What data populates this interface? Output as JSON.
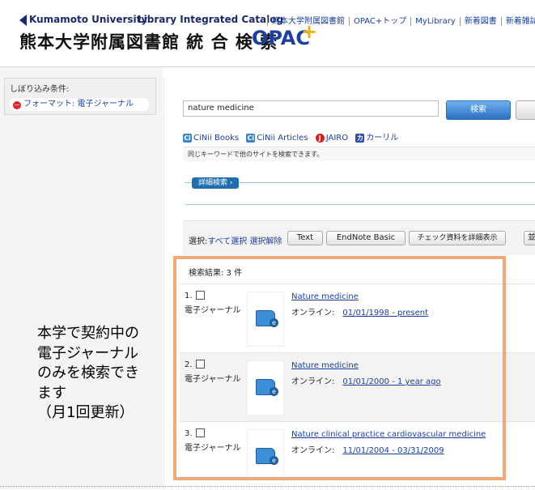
{
  "header": {
    "university": "Kumamoto University",
    "catalog": "Library Integrated Catalog",
    "title_jp": "熊本大学附属図書館 統 合 検 索",
    "opac": "OPAC",
    "plus": "+",
    "nav": [
      "熊本大学附属図書館",
      "OPAC+トップ",
      "MyLibrary",
      "新着図書",
      "新着雑誌"
    ]
  },
  "sidebar": {
    "filter_heading": "しぼり込み条件:",
    "filter_chip": "フォーマット: 電子ジャーナル",
    "remove_glyph": "−"
  },
  "search": {
    "query": "nature medicine",
    "button": "検索"
  },
  "sites": [
    {
      "icon": "Ci",
      "label": "CiNii Books"
    },
    {
      "icon": "Ci",
      "label": "CiNii Articles"
    },
    {
      "icon": "J",
      "label": "JAIRO"
    },
    {
      "icon": "カ",
      "label": "カーリル"
    }
  ],
  "site_note": "同じキーワードで他のサイトを検索できます。",
  "detail_tab": "詳細検索 ›",
  "select_bar": {
    "label": "選択:",
    "select_all": "すべて選択",
    "deselect": "選択解除",
    "text_button": "Text",
    "endnote_button": "EndNote Basic",
    "check_button": "チェック資料を詳細表示",
    "edge_button": "並"
  },
  "results": {
    "count_label": "検索結果: 3 件",
    "items": [
      {
        "num": "1.",
        "type": "電子ジャーナル",
        "title": "Nature medicine",
        "online_label": "オンライン:",
        "range": "01/01/1998 - present"
      },
      {
        "num": "2.",
        "type": "電子ジャーナル",
        "title": "Nature medicine",
        "online_label": "オンライン:",
        "range": "01/01/2000 - 1 year ago"
      },
      {
        "num": "3.",
        "type": "電子ジャーナル",
        "title": "Nature clinical practice cardiovascular medicine",
        "online_label": "オンライン:",
        "range": "11/01/2004 - 03/31/2009"
      }
    ]
  },
  "callout": [
    "本学で契約中の",
    "電子ジャーナル",
    "のみを検索でき",
    "ます",
    "（月1回更新）"
  ],
  "colors": {
    "highlight": "#f0a878",
    "link": "#1a3fa0",
    "button": "#2b6fc2"
  }
}
